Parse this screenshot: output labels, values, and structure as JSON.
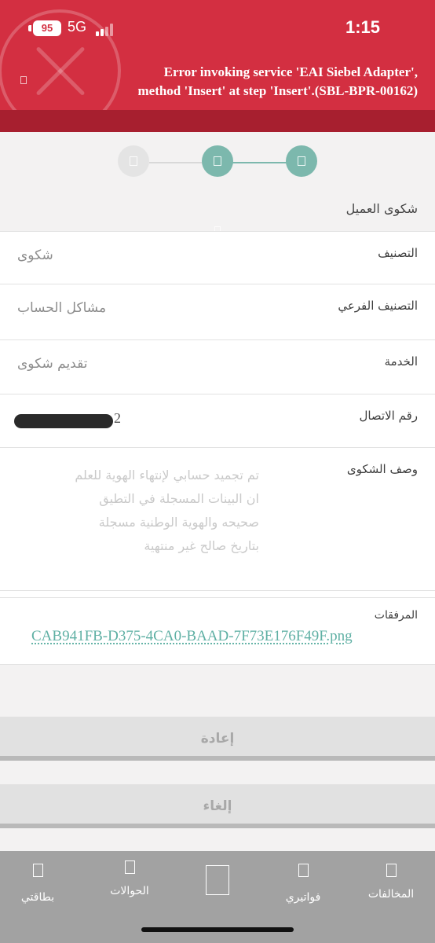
{
  "status_bar": {
    "battery": "95",
    "network": "5G",
    "time": "1:15"
  },
  "error_banner": {
    "line1": "Error invoking service 'EAI Siebel Adapter',",
    "line2": "method 'Insert' at step 'Insert'.(SBL-BPR-00162)",
    "icon": "close-icon",
    "color": "#d32f41",
    "strip_color": "#a71f2f"
  },
  "stepper": {
    "steps": 3,
    "active_steps": 2,
    "active_color": "#7cb8ad",
    "inactive_color": "#e4e4e4"
  },
  "section_title": "شكوى العميل",
  "form": {
    "category": {
      "label": "التصنيف",
      "value": "شكوى"
    },
    "subcategory": {
      "label": "التصنيف الفرعي",
      "value": "مشاكل الحساب"
    },
    "service": {
      "label": "الخدمة",
      "value": "تقديم شكوى"
    },
    "phone": {
      "label": "رقم الاتصال",
      "visible_digit": "2"
    },
    "description": {
      "label": "وصف الشكوى",
      "lines": [
        "تم تجميد حسابي لإنتهاء الهوية للعلم",
        "ان البينات المسجلة في التطيق",
        "صحيحه والهوية الوطنية مسجلة",
        "بتاريخ صالح غير منتهية"
      ]
    },
    "attachments": {
      "label": "المرفقات",
      "file": "CAB941FB-D375-4CA0-BAAD-7F73E176F49F.png",
      "link_color": "#5fb0a4"
    }
  },
  "buttons": {
    "reset": "إعادة",
    "cancel": "إلغاء"
  },
  "tabbar": {
    "items": [
      {
        "label": "بطاقتي",
        "icon": "card-icon"
      },
      {
        "label": "الحوالات",
        "icon": "transfer-icon"
      },
      {
        "label": "",
        "icon": "home-icon"
      },
      {
        "label": "فواتيري",
        "icon": "bill-icon"
      },
      {
        "label": "المخالفات",
        "icon": "violation-icon"
      }
    ]
  }
}
